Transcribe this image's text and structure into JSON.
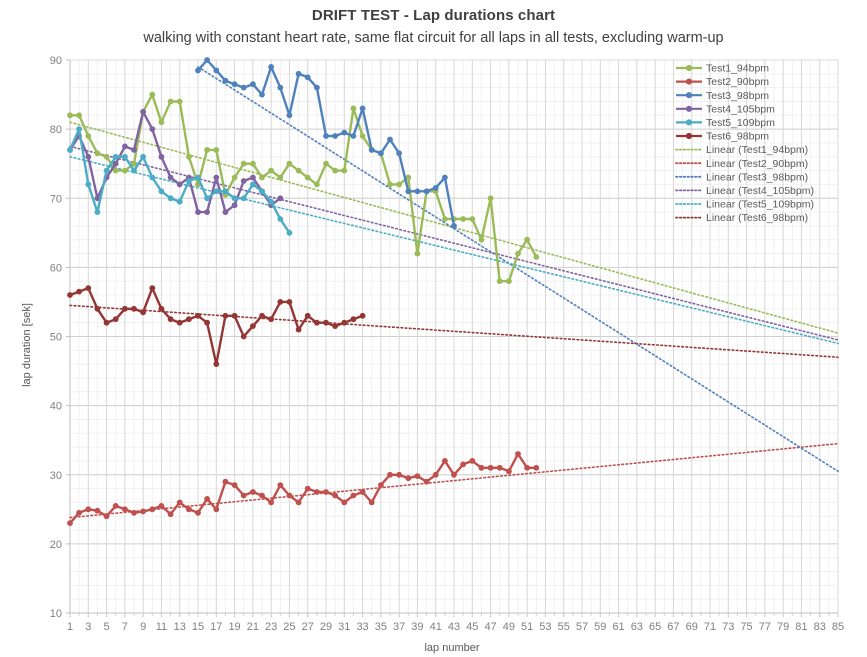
{
  "header": {
    "title": "DRIFT TEST - Lap durations chart",
    "subtitle": "walking with constant heart rate, same flat circuit for all laps in all tests, excluding warm-up"
  },
  "chart_data": {
    "type": "line",
    "title": "DRIFT TEST - Lap durations chart",
    "subtitle": "walking with constant heart rate, same flat circuit for all laps in all tests, excluding warm-up",
    "xlabel": "lap number",
    "ylabel": "lap duration [sek]",
    "xlim": [
      1,
      85
    ],
    "ylim": [
      10,
      90
    ],
    "ytick_step": 10,
    "xtick_step": 2,
    "grid": true,
    "minor_grid": true,
    "legend_position": "top-right",
    "xticks": [
      1,
      3,
      5,
      7,
      9,
      11,
      13,
      15,
      17,
      19,
      21,
      23,
      25,
      27,
      29,
      31,
      33,
      35,
      37,
      39,
      41,
      43,
      45,
      47,
      49,
      51,
      53,
      55,
      57,
      59,
      61,
      63,
      65,
      67,
      69,
      71,
      73,
      75,
      77,
      79,
      81,
      83,
      85
    ],
    "yticks": [
      10,
      20,
      30,
      40,
      50,
      60,
      70,
      80,
      90
    ],
    "colors": {
      "Test1_94bpm": "#9bbb59",
      "Test2_90bpm": "#c0504d",
      "Test3_98bpm": "#4f81bd",
      "Test4_105bpm": "#8064a2",
      "Test5_109bpm": "#4bacc6",
      "Test6_98bpm": "#943634"
    },
    "series": [
      {
        "name": "Test1_94bpm",
        "color": "#9bbb59",
        "x_start": 1,
        "values": [
          82,
          82,
          79,
          76.5,
          76,
          74,
          74,
          75,
          82.5,
          85,
          81,
          84,
          84,
          76,
          72,
          77,
          77,
          70.5,
          73,
          75,
          75,
          73,
          74,
          73,
          75,
          74,
          73,
          72,
          75,
          74,
          74,
          83,
          79,
          77,
          76.5,
          72,
          72,
          73,
          62,
          71,
          71,
          67,
          67,
          67,
          67,
          64,
          70,
          58,
          58,
          62,
          64,
          61.5
        ]
      },
      {
        "name": "Test2_90bpm",
        "color": "#c0504d",
        "x_start": 1,
        "values": [
          23,
          24.5,
          25,
          24.8,
          24,
          25.5,
          25,
          24.5,
          24.7,
          25,
          25.5,
          24.3,
          26,
          25,
          24.5,
          26.5,
          25,
          29,
          28.5,
          27,
          27.5,
          27,
          26,
          28.5,
          27,
          26,
          28,
          27.5,
          27.5,
          27,
          26,
          27,
          27.5,
          26,
          28.5,
          30,
          30,
          29.5,
          29.8,
          29,
          30,
          32,
          30,
          31.5,
          32,
          31,
          31,
          31,
          30.5,
          33,
          31,
          31
        ]
      },
      {
        "name": "Test3_98bpm",
        "color": "#4f81bd",
        "x_start": 15,
        "values": [
          88.5,
          90,
          88.5,
          87,
          86.5,
          86,
          86.5,
          85,
          89,
          86,
          82,
          88,
          87.5,
          86,
          79,
          79,
          79.5,
          79,
          83,
          77,
          76.5,
          78.5,
          76.5,
          71,
          71,
          71,
          71.5,
          73,
          66
        ]
      },
      {
        "name": "Test4_105bpm",
        "color": "#8064a2",
        "x_start": 1,
        "values": [
          77,
          79,
          76,
          70,
          73,
          75,
          77.5,
          77,
          82.5,
          80,
          76,
          73,
          72,
          73,
          68,
          68,
          73,
          68,
          69,
          72.5,
          73,
          71,
          69,
          70
        ]
      },
      {
        "name": "Test5_109bpm",
        "color": "#4bacc6",
        "x_start": 1,
        "values": [
          77,
          80,
          72,
          68,
          74,
          76,
          76,
          74,
          76,
          73,
          71,
          70,
          69.5,
          72.5,
          73,
          70,
          71,
          71,
          70,
          70,
          72,
          71,
          69.5,
          67,
          65
        ]
      },
      {
        "name": "Test6_98bpm",
        "color": "#943634",
        "x_start": 1,
        "values": [
          56,
          56.5,
          57,
          54,
          52,
          52.5,
          54,
          54,
          53.5,
          57,
          54,
          52.5,
          52,
          52.5,
          53,
          52,
          46,
          53,
          53,
          50,
          51.5,
          53,
          52.5,
          55,
          55,
          51,
          53,
          52,
          52,
          51.5,
          52,
          52.5,
          53
        ]
      }
    ],
    "trendlines": [
      {
        "name": "Linear (Test1_94bpm)",
        "color": "#9bbb59",
        "x0": 1,
        "y0": 81.0,
        "x1": 85,
        "y1": 50.5
      },
      {
        "name": "Linear (Test2_90bpm)",
        "color": "#c0504d",
        "x0": 1,
        "y0": 23.8,
        "x1": 85,
        "y1": 34.5
      },
      {
        "name": "Linear (Test3_98bpm)",
        "color": "#4f81bd",
        "x0": 15,
        "y0": 89.0,
        "x1": 85,
        "y1": 30.5
      },
      {
        "name": "Linear (Test4_105bpm)",
        "color": "#8064a2",
        "x0": 1,
        "y0": 77.5,
        "x1": 85,
        "y1": 49.5
      },
      {
        "name": "Linear (Test5_109bpm)",
        "color": "#4bacc6",
        "x0": 1,
        "y0": 76.0,
        "x1": 85,
        "y1": 49.0
      },
      {
        "name": "Linear (Test6_98bpm)",
        "color": "#943634",
        "x0": 1,
        "y0": 54.5,
        "x1": 85,
        "y1": 47.0
      }
    ]
  },
  "legend": {
    "items": [
      {
        "label": "Test1_94bpm",
        "color": "#9bbb59",
        "style": "solid"
      },
      {
        "label": "Test2_90bpm",
        "color": "#c0504d",
        "style": "solid"
      },
      {
        "label": "Test3_98bpm",
        "color": "#4f81bd",
        "style": "solid"
      },
      {
        "label": "Test4_105bpm",
        "color": "#8064a2",
        "style": "solid"
      },
      {
        "label": "Test5_109bpm",
        "color": "#4bacc6",
        "style": "solid"
      },
      {
        "label": "Test6_98bpm",
        "color": "#943634",
        "style": "solid"
      },
      {
        "label": "Linear (Test1_94bpm)",
        "color": "#9bbb59",
        "style": "dotted"
      },
      {
        "label": "Linear (Test2_90bpm)",
        "color": "#c0504d",
        "style": "dotted"
      },
      {
        "label": "Linear (Test3_98bpm)",
        "color": "#4f81bd",
        "style": "dotted"
      },
      {
        "label": "Linear (Test4_105bpm)",
        "color": "#8064a2",
        "style": "dotted"
      },
      {
        "label": "Linear (Test5_109bpm)",
        "color": "#4bacc6",
        "style": "dotted"
      },
      {
        "label": "Linear (Test6_98bpm)",
        "color": "#943634",
        "style": "dotted"
      }
    ]
  },
  "axes": {
    "x_title": "lap number",
    "y_title": "lap duration [sek]"
  }
}
